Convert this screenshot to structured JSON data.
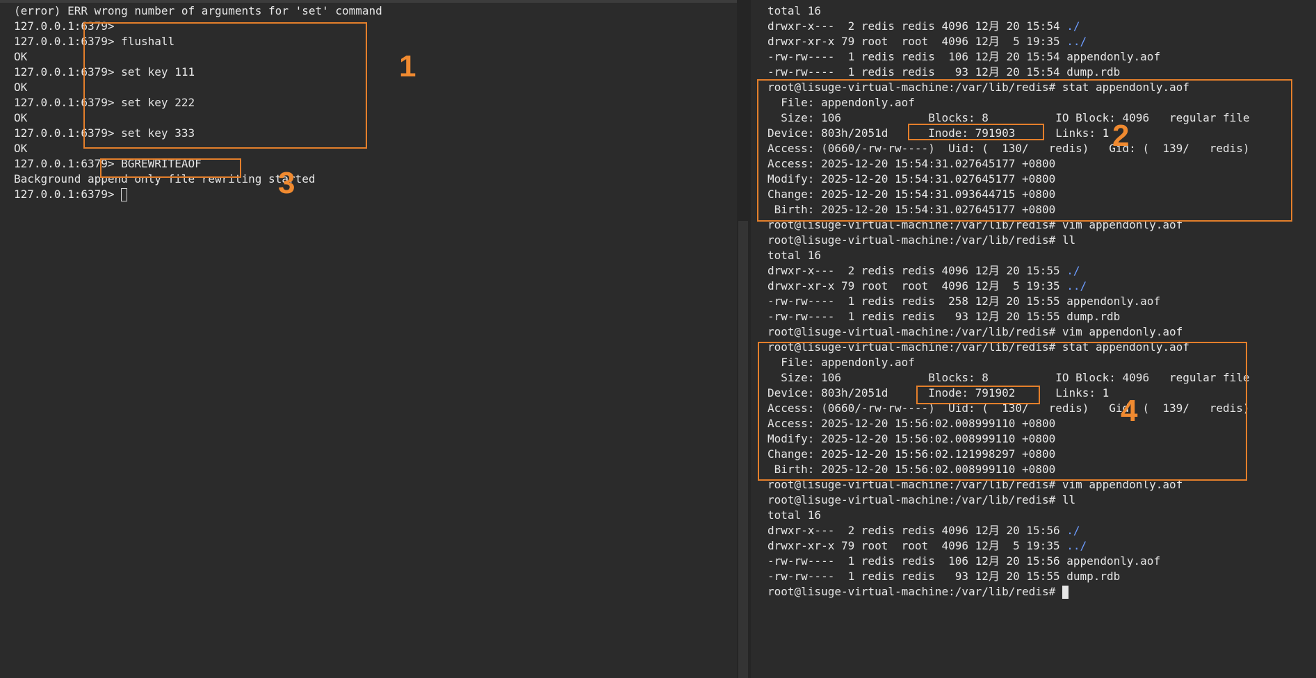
{
  "left_terminal": {
    "lines": [
      "(error) ERR wrong number of arguments for 'set' command",
      "127.0.0.1:6379>",
      "127.0.0.1:6379> flushall",
      "OK",
      "127.0.0.1:6379> set key 111",
      "OK",
      "127.0.0.1:6379> set key 222",
      "OK",
      "127.0.0.1:6379> set key 333",
      "OK",
      "127.0.0.1:6379> BGREWRITEAOF",
      "Background append only file rewriting started"
    ],
    "prompt": "127.0.0.1:6379> "
  },
  "right_terminal": {
    "lines": [
      "total 16",
      "drwxr-x---  2 redis redis 4096 12月 20 15:54 ",
      "drwxr-xr-x 79 root  root  4096 12月  5 19:35 ",
      "-rw-rw----  1 redis redis  106 12月 20 15:54 appendonly.aof",
      "-rw-rw----  1 redis redis   93 12月 20 15:54 dump.rdb",
      "root@lisuge-virtual-machine:/var/lib/redis# stat appendonly.aof",
      "  File: appendonly.aof",
      "  Size: 106             Blocks: 8          IO Block: 4096   regular file",
      "Device: 803h/2051d      Inode: 791903      Links: 1",
      "Access: (0660/-rw-rw----)  Uid: (  130/   redis)   Gid: (  139/   redis)",
      "Access: 2025-12-20 15:54:31.027645177 +0800",
      "Modify: 2025-12-20 15:54:31.027645177 +0800",
      "Change: 2025-12-20 15:54:31.093644715 +0800",
      " Birth: 2025-12-20 15:54:31.027645177 +0800",
      "root@lisuge-virtual-machine:/var/lib/redis# vim appendonly.aof",
      "root@lisuge-virtual-machine:/var/lib/redis# ll",
      "total 16",
      "drwxr-x---  2 redis redis 4096 12月 20 15:55 ",
      "drwxr-xr-x 79 root  root  4096 12月  5 19:35 ",
      "-rw-rw----  1 redis redis  258 12月 20 15:55 appendonly.aof",
      "-rw-rw----  1 redis redis   93 12月 20 15:55 dump.rdb",
      "root@lisuge-virtual-machine:/var/lib/redis# vim appendonly.aof",
      "root@lisuge-virtual-machine:/var/lib/redis# stat appendonly.aof",
      "  File: appendonly.aof",
      "  Size: 106             Blocks: 8          IO Block: 4096   regular file",
      "Device: 803h/2051d      Inode: 791902      Links: 1",
      "Access: (0660/-rw-rw----)  Uid: (  130/   redis)   Gid: (  139/   redis)",
      "Access: 2025-12-20 15:56:02.008999110 +0800",
      "Modify: 2025-12-20 15:56:02.008999110 +0800",
      "Change: 2025-12-20 15:56:02.121998297 +0800",
      " Birth: 2025-12-20 15:56:02.008999110 +0800",
      "root@lisuge-virtual-machine:/var/lib/redis# vim appendonly.aof",
      "root@lisuge-virtual-machine:/var/lib/redis# ll",
      "total 16",
      "drwxr-x---  2 redis redis 4096 12月 20 15:56 ",
      "drwxr-xr-x 79 root  root  4096 12月  5 19:35 ",
      "-rw-rw----  1 redis redis  106 12月 20 15:56 appendonly.aof",
      "-rw-rw----  1 redis redis   93 12月 20 15:55 dump.rdb"
    ],
    "dir_current": "./",
    "dir_parent": "../",
    "prompt": "root@lisuge-virtual-machine:/var/lib/redis# "
  },
  "annotations": {
    "label_1": "1",
    "label_2": "2",
    "label_3": "3",
    "label_4": "4"
  },
  "colors": {
    "background": "#2b2b2b",
    "text": "#e6e6e6",
    "directory": "#6d9cff",
    "annotation": "#e47f2b"
  }
}
